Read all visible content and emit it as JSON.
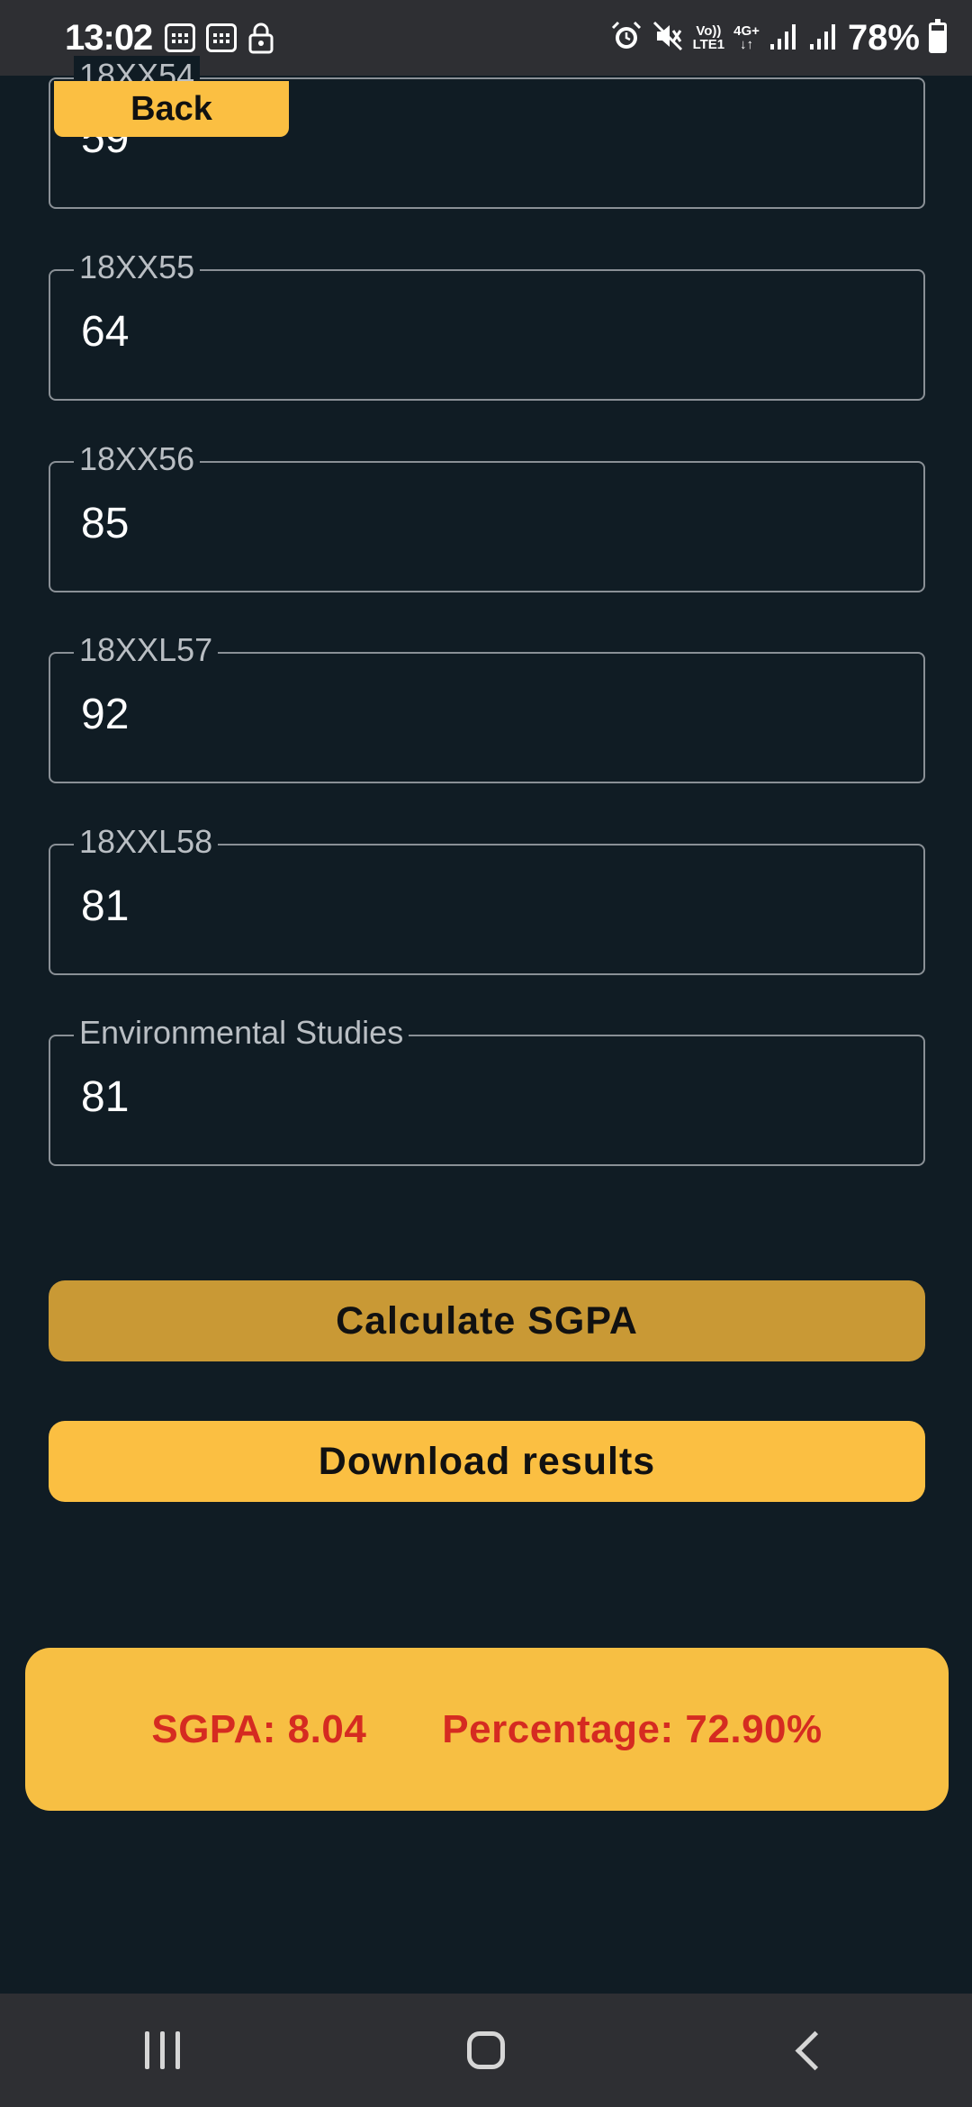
{
  "status_bar": {
    "time": "13:02",
    "network_line1": "Vo))",
    "network_line2": "LTE1",
    "network_type": "4G+",
    "battery": "78%",
    "icons": [
      "sim-icon",
      "sim-icon",
      "lock-icon",
      "alarm-icon",
      "mute-icon",
      "signal-icon",
      "signal-icon",
      "battery-icon"
    ]
  },
  "back_button": "Back",
  "fields": [
    {
      "label": "18XX54",
      "value": "59"
    },
    {
      "label": "18XX55",
      "value": "64"
    },
    {
      "label": "18XX56",
      "value": "85"
    },
    {
      "label": "18XXL57",
      "value": "92"
    },
    {
      "label": "18XXL58",
      "value": "81"
    },
    {
      "label": "Environmental Studies",
      "value": "81"
    }
  ],
  "buttons": {
    "calculate": "Calculate SGPA",
    "download": "Download results"
  },
  "results": {
    "sgpa": "SGPA: 8.04",
    "percentage": "Percentage: 72.90%"
  },
  "colors": {
    "background": "#101c24",
    "accent": "#fbbf42",
    "accent_dark": "#c99935",
    "result_text": "#d52b21"
  },
  "nav_bar": [
    "recents-icon",
    "home-icon",
    "back-icon"
  ]
}
